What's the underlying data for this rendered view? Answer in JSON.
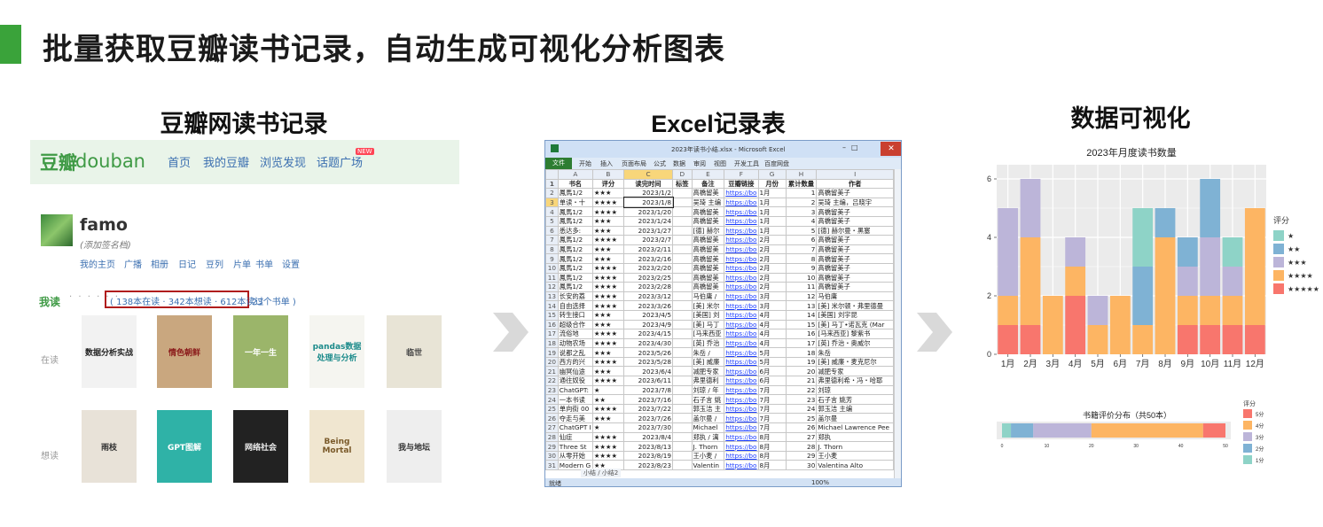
{
  "main_title": "批量获取豆瓣读书记录，自动生成可视化分析图表",
  "sections": {
    "douban_title": "豆瓣网读书记录",
    "excel_title": "Excel记录表",
    "viz_title": "数据可视化"
  },
  "douban": {
    "logo_cn": "豆瓣",
    "logo_en": "douban",
    "nav": [
      "首页",
      "我的豆瓣",
      "浏览发现",
      "话题广场"
    ],
    "new_badge": "NEW",
    "username": "famo",
    "signature": "(添加签名档)",
    "menu": [
      "我的主页",
      "广播",
      "相册",
      "日记",
      "豆列",
      "片单",
      "书单",
      "设置"
    ],
    "read_label": "我读",
    "dots": "· · · · · ·",
    "stats": "( 138本在读 · 342本想读 · 612本读过",
    "booklists": "23个书单 )",
    "reading_label": "在读",
    "wish_label": "想读",
    "reading_books": [
      {
        "title": "数据分析实战",
        "bg": "#f2f2f2",
        "fg": "#222"
      },
      {
        "title": "情色朝鲜",
        "bg": "#c9a77f",
        "fg": "#8b1a1a"
      },
      {
        "title": "一年一生",
        "bg": "#9bb56a",
        "fg": "#fff"
      },
      {
        "title": "pandas数据处理与分析",
        "bg": "#f5f5f0",
        "fg": "#1c8b8b"
      },
      {
        "title": "临世",
        "bg": "#e8e4d6",
        "fg": "#444"
      }
    ],
    "wish_books": [
      {
        "title": "雨枝",
        "bg": "#e8e2d8",
        "fg": "#333"
      },
      {
        "title": "GPT图解",
        "bg": "#2fb2a7",
        "fg": "#fff"
      },
      {
        "title": "网络社会",
        "bg": "#222",
        "fg": "#eee"
      },
      {
        "title": "Being Mortal",
        "bg": "#f0e6d0",
        "fg": "#7a5a2a"
      },
      {
        "title": "我与地坛",
        "bg": "#eee",
        "fg": "#333"
      }
    ]
  },
  "excel": {
    "filename": "2023年读书小结.xlsx - Microsoft Excel",
    "ribbon": [
      "文件",
      "开始",
      "插入",
      "页面布局",
      "公式",
      "数据",
      "审阅",
      "视图",
      "开发工具",
      "百度网盘"
    ],
    "col_letters": [
      "A",
      "B",
      "C",
      "D",
      "E",
      "F",
      "G",
      "H",
      "I"
    ],
    "headers": [
      "书名",
      "评分",
      "读完时间",
      "标签",
      "备注",
      "豆瓣链接",
      "月份",
      "累计数量",
      "作者"
    ],
    "rows": [
      [
        "鳳馬1/2",
        "★★★",
        "2023/1/2",
        "",
        "高橋留美",
        "https://bo",
        "1月",
        "1",
        "高橋留美子"
      ],
      [
        "单读・十",
        "★★★★",
        "2023/1/8",
        "",
        "吴琦 主编",
        "https://bo",
        "1月",
        "2",
        "吴琦 主编，吕晓宇"
      ],
      [
        "鳳馬1/2",
        "★★★★",
        "2023/1/20",
        "",
        "高橋留美",
        "https://bo",
        "1月",
        "3",
        "高橋留美子"
      ],
      [
        "鳳馬1/2",
        "★★★",
        "2023/1/24",
        "",
        "高橋留美",
        "https://bo",
        "1月",
        "4",
        "高橋留美子"
      ],
      [
        "悉达多:",
        "★★★",
        "2023/1/27",
        "",
        "[德] 赫尔",
        "https://bo",
        "1月",
        "5",
        "[德] 赫尔曼・黑塞"
      ],
      [
        "鳳馬1/2",
        "★★★★",
        "2023/2/7",
        "",
        "高橋留美",
        "https://bo",
        "2月",
        "6",
        "高橋留美子"
      ],
      [
        "鳳馬1/2",
        "★★★",
        "2023/2/11",
        "",
        "高橋留美",
        "https://bo",
        "2月",
        "7",
        "高橋留美子"
      ],
      [
        "鳳馬1/2",
        "★★★",
        "2023/2/16",
        "",
        "高橋留美",
        "https://bo",
        "2月",
        "8",
        "高橋留美子"
      ],
      [
        "鳳馬1/2",
        "★★★★",
        "2023/2/20",
        "",
        "高橋留美",
        "https://bo",
        "2月",
        "9",
        "高橋留美子"
      ],
      [
        "鳳馬1/2",
        "★★★★",
        "2023/2/25",
        "",
        "高橋留美",
        "https://bo",
        "2月",
        "10",
        "高橋留美子"
      ],
      [
        "鳳馬1/2",
        "★★★★",
        "2023/2/28",
        "",
        "高橋留美",
        "https://bo",
        "2月",
        "11",
        "高橋留美子"
      ],
      [
        "长安的荔",
        "★★★★",
        "2023/3/12",
        "",
        "马伯庸 /",
        "https://bo",
        "3月",
        "12",
        "马伯庸"
      ],
      [
        "自由选择",
        "★★★★",
        "2023/3/26",
        "",
        "[美] 米尔",
        "https://bo",
        "3月",
        "13",
        "[美] 米尔顿・弗里德曼"
      ],
      [
        "转生接口",
        "★★★",
        "2023/4/5",
        "",
        "[美国] 刘",
        "https://bo",
        "4月",
        "14",
        "[美国] 刘宇昆"
      ],
      [
        "超级合作",
        "★★★",
        "2023/4/9",
        "",
        "[美] 马丁",
        "https://bo",
        "4月",
        "15",
        "[美] 马丁•诺瓦克 (Mar"
      ],
      [
        "流俗地",
        "★★★★",
        "2023/4/15",
        "",
        "[马来西亚",
        "https://bo",
        "4月",
        "16",
        "[马来西亚] 黎紫书"
      ],
      [
        "动物农场",
        "★★★★",
        "2023/4/30",
        "",
        "[英] 乔治",
        "https://bo",
        "4月",
        "17",
        "[英] 乔治・奥威尔"
      ],
      [
        "说都之乱",
        "★★★",
        "2023/5/26",
        "",
        "朱岳 /",
        "https://bo",
        "5月",
        "18",
        "朱岳"
      ],
      [
        "西方的兴",
        "★★★★",
        "2023/5/28",
        "",
        "[美] 威廉",
        "https://bo",
        "5月",
        "19",
        "[美] 威廉・麦克尼尔"
      ],
      [
        "幽冥仙途",
        "★★★",
        "2023/6/4",
        "",
        "减肥专家",
        "https://bo",
        "6月",
        "20",
        "减肥专家"
      ],
      [
        "通往奴役",
        "★★★★",
        "2023/6/11",
        "",
        "弗里德利",
        "https://bo",
        "6月",
        "21",
        "弗里德利希・冯・哈耶"
      ],
      [
        "ChatGPT:",
        "★",
        "2023/7/8",
        "",
        "刘琼 / 年",
        "https://bo",
        "7月",
        "22",
        "刘琼"
      ],
      [
        "一本书读",
        "★★",
        "2023/7/16",
        "",
        "石子言 姚",
        "https://bo",
        "7月",
        "23",
        "石子言 姚芳"
      ],
      [
        "单向街 00",
        "★★★★",
        "2023/7/22",
        "",
        "郭玉洁 主",
        "https://bo",
        "7月",
        "24",
        "郭玉洁 主编"
      ],
      [
        "夺走与美",
        "★★★",
        "2023/7/26",
        "",
        "盖尔曼 /",
        "https://bo",
        "7月",
        "25",
        "盖尔曼"
      ],
      [
        "ChatGPT I",
        "★",
        "2023/7/30",
        "",
        "Michael",
        "https://bo",
        "7月",
        "26",
        "Michael Lawrence Pee"
      ],
      [
        "仙症",
        "★★★★",
        "2023/8/4",
        "",
        "郑执 / 漓",
        "https://bo",
        "8月",
        "27",
        "郑执"
      ],
      [
        "Three St",
        "★★★★",
        "2023/8/13",
        "",
        "J. Thorn",
        "https://bo",
        "8月",
        "28",
        "J. Thorn"
      ],
      [
        "从零开始",
        "★★★★",
        "2023/8/19",
        "",
        "王小麦 /",
        "https://bo",
        "8月",
        "29",
        "王小麦"
      ],
      [
        "Modern G",
        "★★",
        "2023/8/23",
        "",
        "Valentin",
        "https://bo",
        "8月",
        "30",
        "Valentina Alto"
      ]
    ],
    "sheet_tabs": "小结 / 小结2",
    "status_ready": "就绪",
    "zoom": "100%"
  },
  "chart_data": [
    {
      "type": "bar",
      "title": "2023年月度读书数量",
      "categories": [
        "1月",
        "2月",
        "3月",
        "4月",
        "5月",
        "6月",
        "7月",
        "8月",
        "9月",
        "10月",
        "11月",
        "12月"
      ],
      "ylim": [
        0,
        6
      ],
      "yticks": [
        0,
        2,
        4,
        6
      ],
      "legend_title": "评分",
      "legend_position": "right",
      "stacked": true,
      "series": [
        {
          "name": "★★★★★",
          "color": "#f8766d",
          "values": [
            1,
            1,
            0,
            2,
            0,
            0,
            0,
            0,
            1,
            1,
            1,
            1
          ]
        },
        {
          "name": "★★★★",
          "color": "#fdb563",
          "values": [
            1,
            3,
            2,
            1,
            1,
            2,
            1,
            4,
            1,
            1,
            1,
            4
          ]
        },
        {
          "name": "★★★",
          "color": "#bcb5d9",
          "values": [
            3,
            2,
            0,
            1,
            1,
            0,
            0,
            0,
            1,
            2,
            1,
            0
          ]
        },
        {
          "name": "★★",
          "color": "#7fb2d4",
          "values": [
            0,
            0,
            0,
            0,
            0,
            0,
            2,
            1,
            1,
            2,
            0,
            0
          ]
        },
        {
          "name": "★",
          "color": "#8ed3c7",
          "values": [
            0,
            0,
            0,
            0,
            0,
            0,
            2,
            0,
            0,
            0,
            1,
            0
          ]
        }
      ]
    },
    {
      "type": "bar",
      "orientation": "horizontal",
      "title": "书籍评价分布（共50本）",
      "xlim": [
        0,
        50
      ],
      "xticks": [
        0,
        10,
        20,
        30,
        40,
        50
      ],
      "legend_title": "评分",
      "legend_position": "right",
      "stacked": true,
      "series": [
        {
          "name": "1分",
          "color": "#8ed3c7",
          "values": [
            2
          ]
        },
        {
          "name": "2分",
          "color": "#7fb2d4",
          "values": [
            5
          ]
        },
        {
          "name": "3分",
          "color": "#bcb5d9",
          "values": [
            13
          ]
        },
        {
          "name": "4分",
          "color": "#fdb563",
          "values": [
            25
          ]
        },
        {
          "name": "5分",
          "color": "#f8766d",
          "values": [
            5
          ]
        }
      ]
    }
  ]
}
